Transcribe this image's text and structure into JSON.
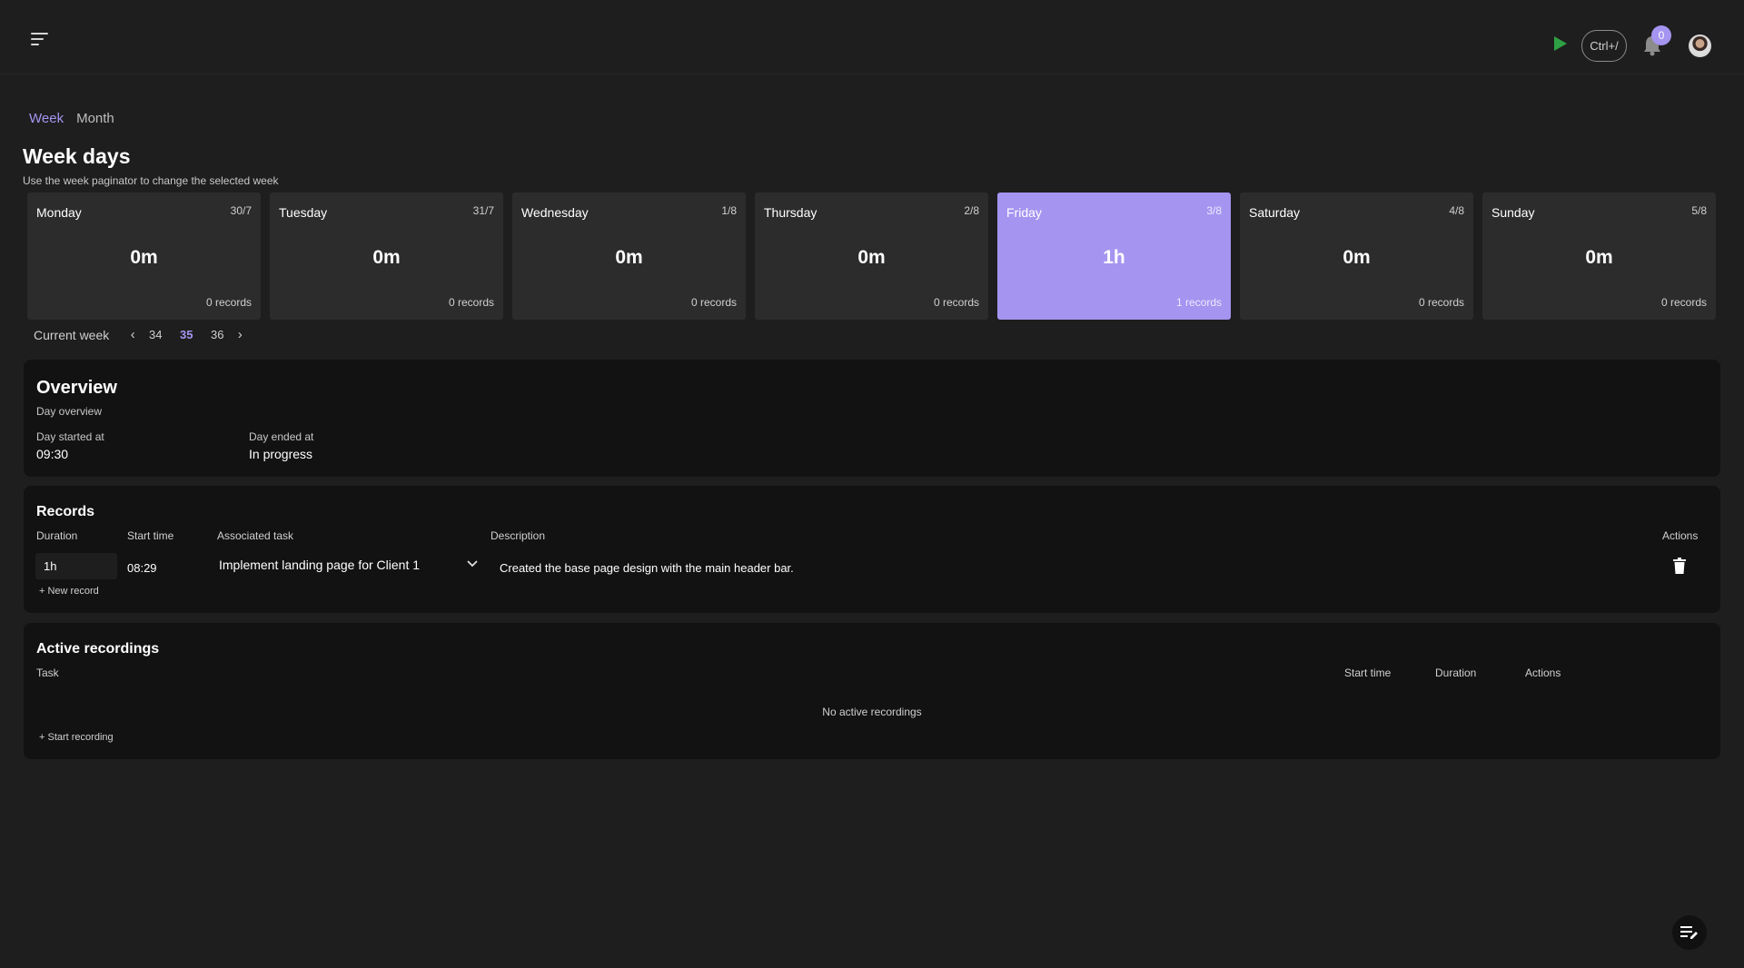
{
  "header": {
    "shortcut_label": "Ctrl+/",
    "notification_count": "0"
  },
  "view_tabs": [
    {
      "label": "Week",
      "active": true
    },
    {
      "label": "Month",
      "active": false
    }
  ],
  "week": {
    "title": "Week days",
    "subtitle": "Use the week paginator to change the selected week",
    "days": [
      {
        "name": "Monday",
        "date": "30/7",
        "total": "0m",
        "records": "0 records"
      },
      {
        "name": "Tuesday",
        "date": "31/7",
        "total": "0m",
        "records": "0 records"
      },
      {
        "name": "Wednesday",
        "date": "1/8",
        "total": "0m",
        "records": "0 records"
      },
      {
        "name": "Thursday",
        "date": "2/8",
        "total": "0m",
        "records": "0 records"
      },
      {
        "name": "Friday",
        "date": "3/8",
        "total": "1h",
        "records": "1 records",
        "selected": true
      },
      {
        "name": "Saturday",
        "date": "4/8",
        "total": "0m",
        "records": "0 records"
      },
      {
        "name": "Sunday",
        "date": "5/8",
        "total": "0m",
        "records": "0 records"
      }
    ]
  },
  "pager": {
    "label": "Current week",
    "weeks": [
      "34",
      "35",
      "36"
    ],
    "active_week": "35"
  },
  "overview": {
    "title": "Overview",
    "subtitle": "Day overview",
    "started_label": "Day started at",
    "started_value": "09:30",
    "ended_label": "Day ended at",
    "ended_value": "In progress"
  },
  "records": {
    "title": "Records",
    "columns": {
      "duration": "Duration",
      "start": "Start time",
      "task": "Associated task",
      "description": "Description",
      "actions": "Actions"
    },
    "rows": [
      {
        "duration": "1h",
        "start": "08:29",
        "task": "Implement landing page for Client 1",
        "description": "Created the base page design with the main header bar."
      }
    ],
    "new_label": "+ New record"
  },
  "active_recordings": {
    "title": "Active recordings",
    "columns": {
      "task": "Task",
      "start": "Start time",
      "duration": "Duration",
      "actions": "Actions"
    },
    "empty_text": "No active recordings",
    "start_label": "+ Start recording"
  },
  "colors": {
    "accent": "#a594f0",
    "play": "#2ea043",
    "card": "#121212",
    "background": "#1e1e1e",
    "day_card": "#2c2c2c"
  },
  "icons": [
    "menu-icon",
    "play-icon",
    "bell-icon",
    "avatar",
    "chevron-left-icon",
    "chevron-right-icon",
    "chevron-down-icon",
    "trash-icon",
    "edit-note-icon"
  ]
}
